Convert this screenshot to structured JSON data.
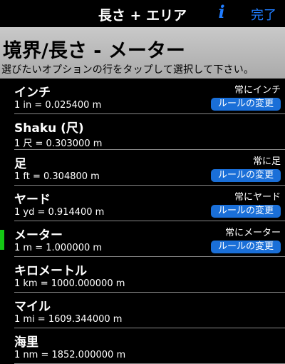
{
  "navbar": {
    "title": "長さ + エリア",
    "info_label": "i",
    "done_label": "完了"
  },
  "header": {
    "title": "境界/長さ - メーター",
    "subtitle": "選びたいオプションの行をタップして選択して下さい。"
  },
  "colors": {
    "accent": "#1f7cff",
    "button": "#1a6fd8",
    "selected_marker": "#14c814",
    "header_bg": "#bbbbbb"
  },
  "units": [
    {
      "name": "インチ",
      "value": "1 in = 0.025400 m",
      "rule": "常にインチ",
      "button": "ルールの変更"
    },
    {
      "name": "Shaku (尺)",
      "value": "1 尺 = 0.303000 m",
      "rule": "",
      "button": ""
    },
    {
      "name": "足",
      "value": "1 ft = 0.304800 m",
      "rule": "常に足",
      "button": "ルールの変更"
    },
    {
      "name": "ヤード",
      "value": "1 yd = 0.914400 m",
      "rule": "常にヤード",
      "button": "ルールの変更"
    },
    {
      "name": "メーター",
      "value": "1 m = 1.000000 m",
      "rule": "常にメーター",
      "button": "ルールの変更"
    },
    {
      "name": "キロメートル",
      "value": "1 km = 1000.000000 m",
      "rule": "",
      "button": ""
    },
    {
      "name": "マイル",
      "value": "1 mi = 1609.344000 m",
      "rule": "",
      "button": ""
    },
    {
      "name": "海里",
      "value": "1 nm = 1852.000000 m",
      "rule": "",
      "button": ""
    }
  ]
}
